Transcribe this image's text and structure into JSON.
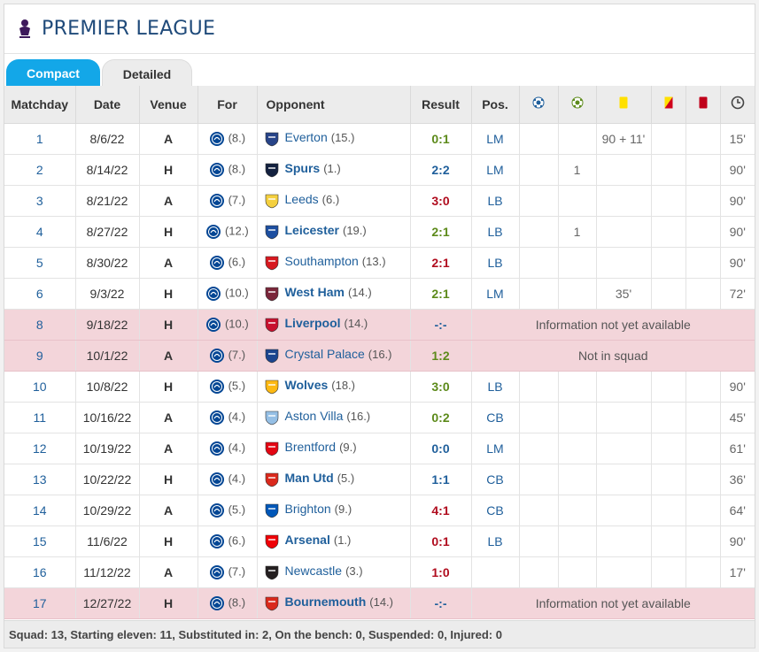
{
  "header": {
    "title": "PREMIER LEAGUE"
  },
  "tabs": [
    {
      "label": "Compact"
    },
    {
      "label": "Detailed"
    }
  ],
  "columns": {
    "matchday": "Matchday",
    "date": "Date",
    "venue": "Venue",
    "for": "For",
    "opponent": "Opponent",
    "result": "Result",
    "pos": "Pos."
  },
  "rows": [
    {
      "md": "1",
      "date": "8/6/22",
      "venue": "A",
      "for_rank": "(8.)",
      "opp": "Everton",
      "opp_rank": "(15.)",
      "opp_bold": false,
      "result": "0:1",
      "res_class": "win",
      "pos": "LM",
      "goals": "",
      "assists": "",
      "yellow": "90 + 11'",
      "second_yellow": "",
      "red": "",
      "mins": "15'",
      "note": "",
      "pink": false,
      "crest": "#274488"
    },
    {
      "md": "2",
      "date": "8/14/22",
      "venue": "H",
      "for_rank": "(8.)",
      "opp": "Spurs",
      "opp_rank": "(1.)",
      "opp_bold": true,
      "result": "2:2",
      "res_class": "draw",
      "pos": "LM",
      "goals": "",
      "assists": "1",
      "yellow": "",
      "second_yellow": "",
      "red": "",
      "mins": "90'",
      "note": "",
      "pink": false,
      "crest": "#13213f"
    },
    {
      "md": "3",
      "date": "8/21/22",
      "venue": "A",
      "for_rank": "(7.)",
      "opp": "Leeds",
      "opp_rank": "(6.)",
      "opp_bold": false,
      "result": "3:0",
      "res_class": "loss",
      "pos": "LB",
      "goals": "",
      "assists": "",
      "yellow": "",
      "second_yellow": "",
      "red": "",
      "mins": "90'",
      "note": "",
      "pink": false,
      "crest": "#f4d03f"
    },
    {
      "md": "4",
      "date": "8/27/22",
      "venue": "H",
      "for_rank": "(12.)",
      "opp": "Leicester",
      "opp_rank": "(19.)",
      "opp_bold": true,
      "result": "2:1",
      "res_class": "win",
      "pos": "LB",
      "goals": "",
      "assists": "1",
      "yellow": "",
      "second_yellow": "",
      "red": "",
      "mins": "90'",
      "note": "",
      "pink": false,
      "crest": "#1d4fa0"
    },
    {
      "md": "5",
      "date": "8/30/22",
      "venue": "A",
      "for_rank": "(6.)",
      "opp": "Southampton",
      "opp_rank": "(13.)",
      "opp_bold": false,
      "result": "2:1",
      "res_class": "loss",
      "pos": "LB",
      "goals": "",
      "assists": "",
      "yellow": "",
      "second_yellow": "",
      "red": "",
      "mins": "90'",
      "note": "",
      "pink": false,
      "crest": "#d71920"
    },
    {
      "md": "6",
      "date": "9/3/22",
      "venue": "H",
      "for_rank": "(10.)",
      "opp": "West Ham",
      "opp_rank": "(14.)",
      "opp_bold": true,
      "result": "2:1",
      "res_class": "win",
      "pos": "LM",
      "goals": "",
      "assists": "",
      "yellow": "35'",
      "second_yellow": "",
      "red": "",
      "mins": "72'",
      "note": "",
      "pink": false,
      "crest": "#7a263a"
    },
    {
      "md": "8",
      "date": "9/18/22",
      "venue": "H",
      "for_rank": "(10.)",
      "opp": "Liverpool",
      "opp_rank": "(14.)",
      "opp_bold": true,
      "result": "-:-",
      "res_class": "draw",
      "pos": "",
      "goals": "",
      "assists": "",
      "yellow": "",
      "second_yellow": "",
      "red": "",
      "mins": "",
      "note": "Information not yet available",
      "pink": true,
      "crest": "#c8102e"
    },
    {
      "md": "9",
      "date": "10/1/22",
      "venue": "A",
      "for_rank": "(7.)",
      "opp": "Crystal Palace",
      "opp_rank": "(16.)",
      "opp_bold": false,
      "result": "1:2",
      "res_class": "win",
      "pos": "",
      "goals": "",
      "assists": "",
      "yellow": "",
      "second_yellow": "",
      "red": "",
      "mins": "",
      "note": "Not in squad",
      "pink": true,
      "crest": "#1b458f"
    },
    {
      "md": "10",
      "date": "10/8/22",
      "venue": "H",
      "for_rank": "(5.)",
      "opp": "Wolves",
      "opp_rank": "(18.)",
      "opp_bold": true,
      "result": "3:0",
      "res_class": "win",
      "pos": "LB",
      "goals": "",
      "assists": "",
      "yellow": "",
      "second_yellow": "",
      "red": "",
      "mins": "90'",
      "note": "",
      "pink": false,
      "crest": "#fdb913"
    },
    {
      "md": "11",
      "date": "10/16/22",
      "venue": "A",
      "for_rank": "(4.)",
      "opp": "Aston Villa",
      "opp_rank": "(16.)",
      "opp_bold": false,
      "result": "0:2",
      "res_class": "win",
      "pos": "CB",
      "goals": "",
      "assists": "",
      "yellow": "",
      "second_yellow": "",
      "red": "",
      "mins": "45'",
      "note": "",
      "pink": false,
      "crest": "#95bfe5"
    },
    {
      "md": "12",
      "date": "10/19/22",
      "venue": "A",
      "for_rank": "(4.)",
      "opp": "Brentford",
      "opp_rank": "(9.)",
      "opp_bold": false,
      "result": "0:0",
      "res_class": "draw",
      "pos": "LM",
      "goals": "",
      "assists": "",
      "yellow": "",
      "second_yellow": "",
      "red": "",
      "mins": "61'",
      "note": "",
      "pink": false,
      "crest": "#e30613"
    },
    {
      "md": "13",
      "date": "10/22/22",
      "venue": "H",
      "for_rank": "(4.)",
      "opp": "Man Utd",
      "opp_rank": "(5.)",
      "opp_bold": true,
      "result": "1:1",
      "res_class": "draw",
      "pos": "CB",
      "goals": "",
      "assists": "",
      "yellow": "",
      "second_yellow": "",
      "red": "",
      "mins": "36'",
      "note": "",
      "pink": false,
      "crest": "#da291c"
    },
    {
      "md": "14",
      "date": "10/29/22",
      "venue": "A",
      "for_rank": "(5.)",
      "opp": "Brighton",
      "opp_rank": "(9.)",
      "opp_bold": false,
      "result": "4:1",
      "res_class": "loss",
      "pos": "CB",
      "goals": "",
      "assists": "",
      "yellow": "",
      "second_yellow": "",
      "red": "",
      "mins": "64'",
      "note": "",
      "pink": false,
      "crest": "#0057b8"
    },
    {
      "md": "15",
      "date": "11/6/22",
      "venue": "H",
      "for_rank": "(6.)",
      "opp": "Arsenal",
      "opp_rank": "(1.)",
      "opp_bold": true,
      "result": "0:1",
      "res_class": "loss",
      "pos": "LB",
      "goals": "",
      "assists": "",
      "yellow": "",
      "second_yellow": "",
      "red": "",
      "mins": "90'",
      "note": "",
      "pink": false,
      "crest": "#ef0107"
    },
    {
      "md": "16",
      "date": "11/12/22",
      "venue": "A",
      "for_rank": "(7.)",
      "opp": "Newcastle",
      "opp_rank": "(3.)",
      "opp_bold": false,
      "result": "1:0",
      "res_class": "loss",
      "pos": "",
      "goals": "",
      "assists": "",
      "yellow": "",
      "second_yellow": "",
      "red": "",
      "mins": "17'",
      "note": "",
      "pink": false,
      "crest": "#241f20"
    },
    {
      "md": "17",
      "date": "12/27/22",
      "venue": "H",
      "for_rank": "(8.)",
      "opp": "Bournemouth",
      "opp_rank": "(14.)",
      "opp_bold": true,
      "result": "-:-",
      "res_class": "draw",
      "pos": "",
      "goals": "",
      "assists": "",
      "yellow": "",
      "second_yellow": "",
      "red": "",
      "mins": "",
      "note": "Information not yet available",
      "pink": true,
      "crest": "#da291c"
    }
  ],
  "footer": {
    "text": "Squad: 13, Starting eleven: 11, Substituted in: 2, On the bench: 0, Suspended: 0, Injured: 0"
  },
  "colors": {
    "accent": "#13a7e8",
    "link": "#1f5f9b",
    "pink_row": "#f3d5da",
    "header_bg": "#ececec"
  },
  "icons": {
    "goal": "ball-icon",
    "assist": "assist-ball-icon",
    "yellow": "yellow-card-icon",
    "second_yellow": "second-yellow-card-icon",
    "red": "red-card-icon",
    "minutes": "clock-icon",
    "chelsea_crest": "chelsea-crest-icon"
  }
}
